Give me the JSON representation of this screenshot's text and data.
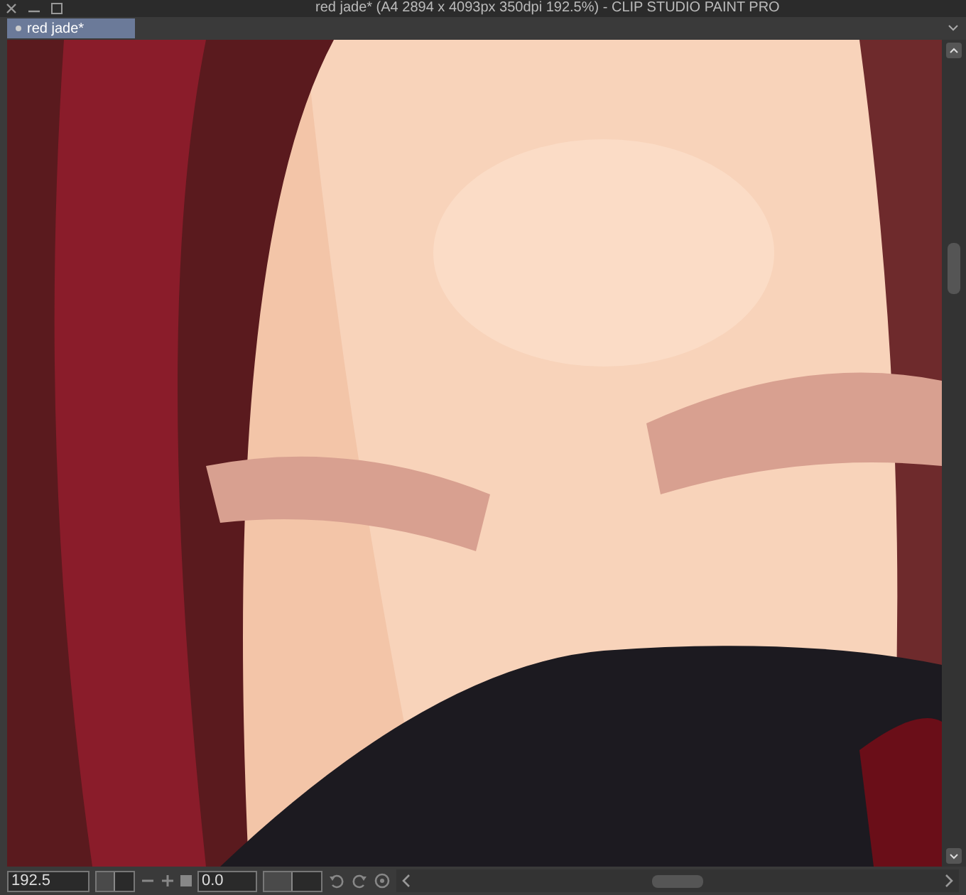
{
  "window": {
    "title": "red jade* (A4 2894 x 4093px 350dpi 192.5%) - CLIP STUDIO PAINT PRO"
  },
  "tabs": [
    {
      "label": "red jade*",
      "selected": true
    }
  ],
  "status_bar": {
    "zoom": "192.5",
    "zoom_slider": {
      "level": 0.5
    },
    "rotation": "0.0",
    "rotation_slider": {
      "level": 0.5
    }
  }
}
